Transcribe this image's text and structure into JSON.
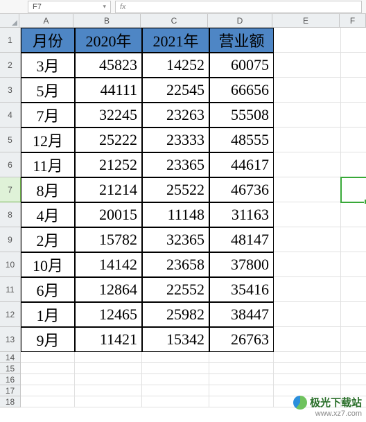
{
  "namebox": {
    "value": "F7"
  },
  "formulabar": {
    "prefix": "fx",
    "value": ""
  },
  "columns": [
    "A",
    "B",
    "C",
    "D",
    "E",
    "F"
  ],
  "rownums": [
    "1",
    "2",
    "3",
    "4",
    "5",
    "6",
    "7",
    "8",
    "9",
    "10",
    "11",
    "12",
    "13",
    "14",
    "15",
    "16",
    "17",
    "18"
  ],
  "active_row_index": 6,
  "table": {
    "header": {
      "c0": "月份",
      "c1": "2020年",
      "c2": "2021年",
      "c3": "营业额"
    },
    "rows": [
      {
        "c0": "3月",
        "c1": "45823",
        "c2": "14252",
        "c3": "60075"
      },
      {
        "c0": "5月",
        "c1": "44111",
        "c2": "22545",
        "c3": "66656"
      },
      {
        "c0": "7月",
        "c1": "32245",
        "c2": "23263",
        "c3": "55508"
      },
      {
        "c0": "12月",
        "c1": "25222",
        "c2": "23333",
        "c3": "48555"
      },
      {
        "c0": "11月",
        "c1": "21252",
        "c2": "23365",
        "c3": "44617"
      },
      {
        "c0": "8月",
        "c1": "21214",
        "c2": "25522",
        "c3": "46736"
      },
      {
        "c0": "4月",
        "c1": "20015",
        "c2": "11148",
        "c3": "31163"
      },
      {
        "c0": "2月",
        "c1": "15782",
        "c2": "32365",
        "c3": "48147"
      },
      {
        "c0": "10月",
        "c1": "14142",
        "c2": "23658",
        "c3": "37800"
      },
      {
        "c0": "6月",
        "c1": "12864",
        "c2": "22552",
        "c3": "35416"
      },
      {
        "c0": "1月",
        "c1": "12465",
        "c2": "25982",
        "c3": "38447"
      },
      {
        "c0": "9月",
        "c1": "11421",
        "c2": "15342",
        "c3": "26763"
      }
    ]
  },
  "selection": {
    "col": "F",
    "row": 7
  },
  "watermark": {
    "title": "极光下载站",
    "url": "www.xz7.com"
  }
}
